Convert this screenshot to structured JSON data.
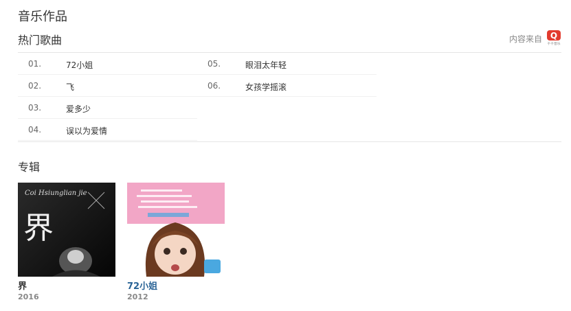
{
  "header": {
    "title": "音乐作品",
    "subtitle": "热门歌曲",
    "source_label": "内容来自",
    "source_logo_text": "千千音乐"
  },
  "songs": [
    {
      "no": "01.",
      "name": "72小姐"
    },
    {
      "no": "02.",
      "name": "飞"
    },
    {
      "no": "03.",
      "name": "爱多少"
    },
    {
      "no": "04.",
      "name": "误以为爱情"
    },
    {
      "no": "05.",
      "name": "眼泪太年轻"
    },
    {
      "no": "06.",
      "name": "女孩学摇滚"
    }
  ],
  "albums_section": {
    "title": "专辑"
  },
  "albums": [
    {
      "name": "界",
      "year": "2016",
      "cover_text": "界",
      "cover_sub": "Coi Hsiunglian jie"
    },
    {
      "name": "72小姐",
      "year": "2012"
    }
  ],
  "colors": {
    "link": "#2a6496",
    "brand_red": "#e23b2e",
    "pink": "#f2a6c6"
  }
}
